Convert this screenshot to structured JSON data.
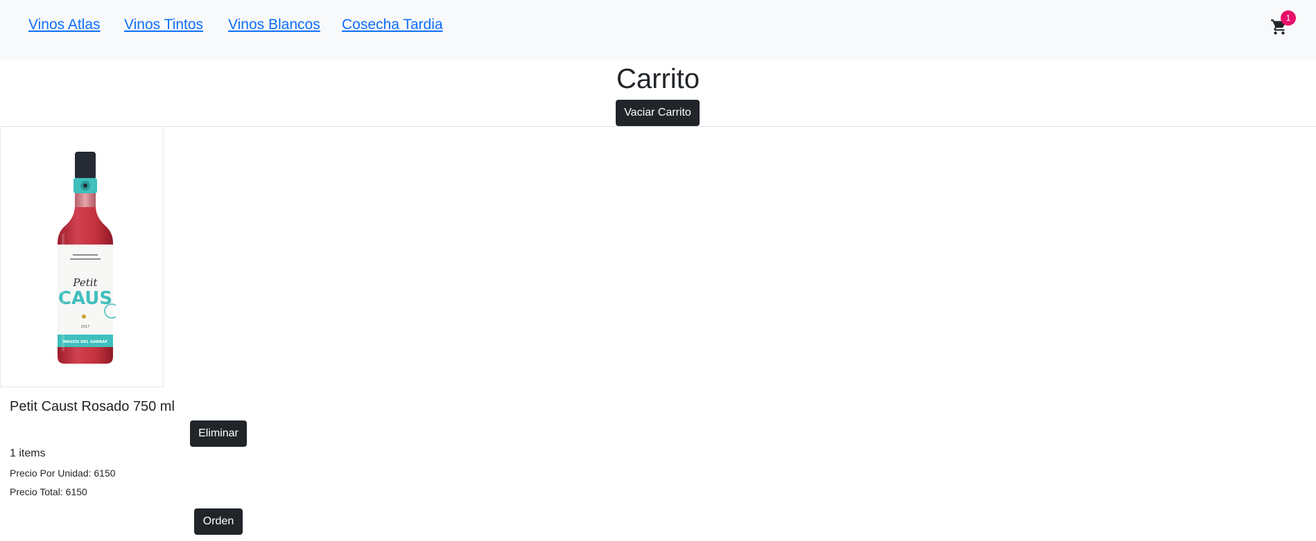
{
  "nav": {
    "links": [
      "Vinos Atlas",
      "Vinos Tintos",
      "Vinos Blancos",
      "Cosecha Tardia"
    ],
    "cart_icon": "shopping-cart-icon",
    "cart_count": "1"
  },
  "page": {
    "title": "Carrito",
    "empty_cart_label": "Vaciar Carrito"
  },
  "cart": {
    "items": [
      {
        "name": "Petit Caust Rosado 750 ml",
        "image": "rose-wine-bottle",
        "remove_label": "Eliminar",
        "label_text": {
          "brand_top": "Petit",
          "brand_main": "CAUS",
          "vintage": "2017",
          "region": "MASSÍS DEL GARRAF"
        }
      }
    ],
    "count_text": "1 items",
    "unit_price_text": "Precio Por Unidad: 6150",
    "total_price_text": "Precio Total: 6150",
    "order_label": "Orden"
  },
  "colors": {
    "link": "#0d6efd",
    "button_dark": "#212529",
    "badge": "#e8106a",
    "navbar_bg": "#f8f9fa",
    "wine": "#c4313e",
    "label_teal": "#3fbfbd"
  }
}
